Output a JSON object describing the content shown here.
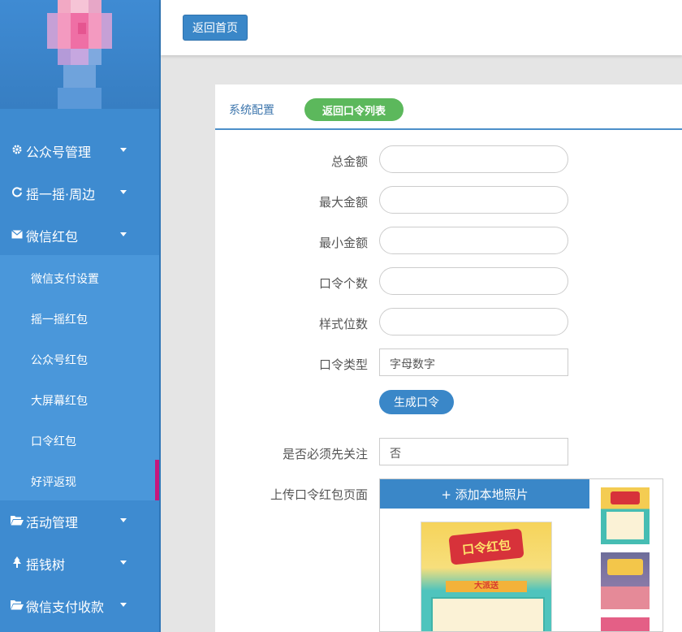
{
  "sidebar": {
    "nav": [
      {
        "label": "公众号管理",
        "icon": "gear-icon"
      },
      {
        "label": "摇一摇·周边",
        "icon": "refresh-icon"
      },
      {
        "label": "微信红包",
        "icon": "envelope-icon"
      },
      {
        "label": "活动管理",
        "icon": "folder-open-icon"
      },
      {
        "label": "摇钱树",
        "icon": "tree-icon"
      },
      {
        "label": "微信支付收款",
        "icon": "folder-open-icon"
      }
    ],
    "submenu": [
      "微信支付设置",
      "摇一摇红包",
      "公众号红包",
      "大屏幕红包",
      "口令红包",
      "好评返现"
    ],
    "active_sub": "好评返现",
    "colors": {
      "background": "#3e8bd0",
      "submenu_background": "#4a97da",
      "active_marker": "#c6177d"
    }
  },
  "topbar": {
    "home_button": "返回首页"
  },
  "panel": {
    "title": "系统配置",
    "back_button": "返回口令列表",
    "fields": {
      "total_amount": {
        "label": "总金额",
        "value": ""
      },
      "max_amount": {
        "label": "最大金额",
        "value": ""
      },
      "min_amount": {
        "label": "最小金额",
        "value": ""
      },
      "code_count": {
        "label": "口令个数",
        "value": ""
      },
      "style_digits": {
        "label": "样式位数",
        "value": ""
      },
      "code_type": {
        "label": "口令类型",
        "value": "字母数字"
      },
      "must_follow": {
        "label": "是否必须先关注",
        "value": "否"
      },
      "upload_page": {
        "label": "上传口令红包页面"
      }
    },
    "generate_button": "生成口令",
    "add_photo_button": "+ 添加本地照片",
    "preview": {
      "banner_text": "口令红包",
      "ribbon_text": "大派送"
    },
    "colors": {
      "primary": "#3a87c8",
      "success": "#5cb85c",
      "title": "#3d76ad"
    }
  }
}
